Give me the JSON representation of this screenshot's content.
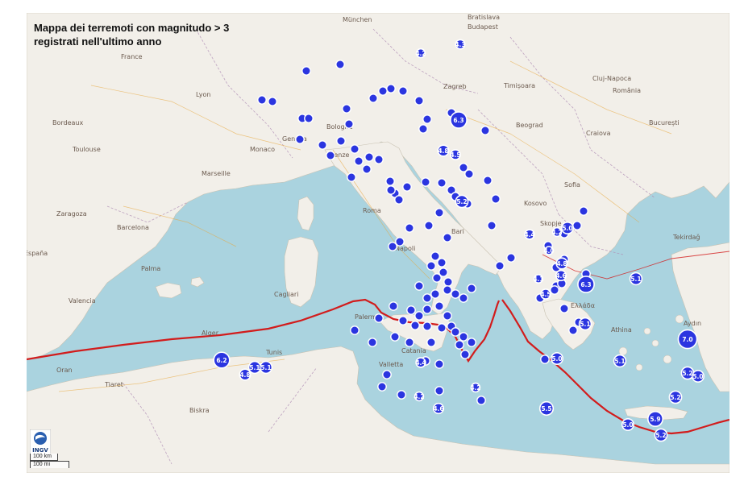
{
  "map": {
    "title_line1": "Mappa dei terremoti con magnitudo > 3",
    "title_line2": "registrati nell'ultimo anno",
    "logo_text": "INGV",
    "scale_km": "100 km",
    "scale_mi": "100 mi",
    "colors": {
      "sea": "#aad3df",
      "land": "#f2efe9",
      "event_fill": "#2b35e0",
      "event_stroke": "#1a1f8a",
      "fault_line": "#d21c1c"
    }
  },
  "places": [
    {
      "name": "München"
    },
    {
      "name": "Wien"
    },
    {
      "name": "Bratislava"
    },
    {
      "name": "Budapest"
    },
    {
      "name": "France"
    },
    {
      "name": "Lyon"
    },
    {
      "name": "Bordeaux"
    },
    {
      "name": "Toulouse"
    },
    {
      "name": "Marseille"
    },
    {
      "name": "Zaragoza"
    },
    {
      "name": "Barcelona"
    },
    {
      "name": "España"
    },
    {
      "name": "Valencia"
    },
    {
      "name": "Palma"
    },
    {
      "name": "Genova"
    },
    {
      "name": "Monaco"
    },
    {
      "name": "Bologna"
    },
    {
      "name": "Firenze"
    },
    {
      "name": "Roma"
    },
    {
      "name": "Napoli"
    },
    {
      "name": "Bari"
    },
    {
      "name": "Palermo"
    },
    {
      "name": "Catania"
    },
    {
      "name": "Cagliari"
    },
    {
      "name": "Zagreb"
    },
    {
      "name": "Beograd"
    },
    {
      "name": "România"
    },
    {
      "name": "București"
    },
    {
      "name": "Sofia"
    },
    {
      "name": "Tunis"
    },
    {
      "name": "Alger"
    },
    {
      "name": "Oran"
    },
    {
      "name": "Biskra"
    },
    {
      "name": "Tiaret"
    },
    {
      "name": "Valletta"
    },
    {
      "name": "Athina"
    },
    {
      "name": "Kosovo"
    },
    {
      "name": "Timișoara"
    },
    {
      "name": "Cluj-Napoca"
    },
    {
      "name": "Craiova"
    },
    {
      "name": "Skopje"
    },
    {
      "name": "Tekirdağ"
    },
    {
      "name": "Aydın"
    },
    {
      "name": "Ελλάδα"
    }
  ],
  "labeled_events": [
    {
      "mag": "4.2"
    },
    {
      "mag": "4.3"
    },
    {
      "mag": "6.3"
    },
    {
      "mag": "4.8"
    },
    {
      "mag": "4.5"
    },
    {
      "mag": "5.2"
    },
    {
      "mag": "4.4"
    },
    {
      "mag": "5.0"
    },
    {
      "mag": "4.2"
    },
    {
      "mag": "4.0"
    },
    {
      "mag": "4.8"
    },
    {
      "mag": "4.6"
    },
    {
      "mag": "4.1"
    },
    {
      "mag": "4.5"
    },
    {
      "mag": "6.3"
    },
    {
      "mag": "5.1"
    },
    {
      "mag": "5.1"
    },
    {
      "mag": "7.0"
    },
    {
      "mag": "5.1"
    },
    {
      "mag": "5.0"
    },
    {
      "mag": "5.2"
    },
    {
      "mag": "5.0"
    },
    {
      "mag": "5.2"
    },
    {
      "mag": "5.0"
    },
    {
      "mag": "5.9"
    },
    {
      "mag": "5.2"
    },
    {
      "mag": "5.5"
    },
    {
      "mag": "4.4"
    },
    {
      "mag": "4.2"
    },
    {
      "mag": "4.2"
    },
    {
      "mag": "4.6"
    },
    {
      "mag": "6.2"
    },
    {
      "mag": "4.8"
    },
    {
      "mag": "5.1"
    },
    {
      "mag": "5.1"
    }
  ]
}
